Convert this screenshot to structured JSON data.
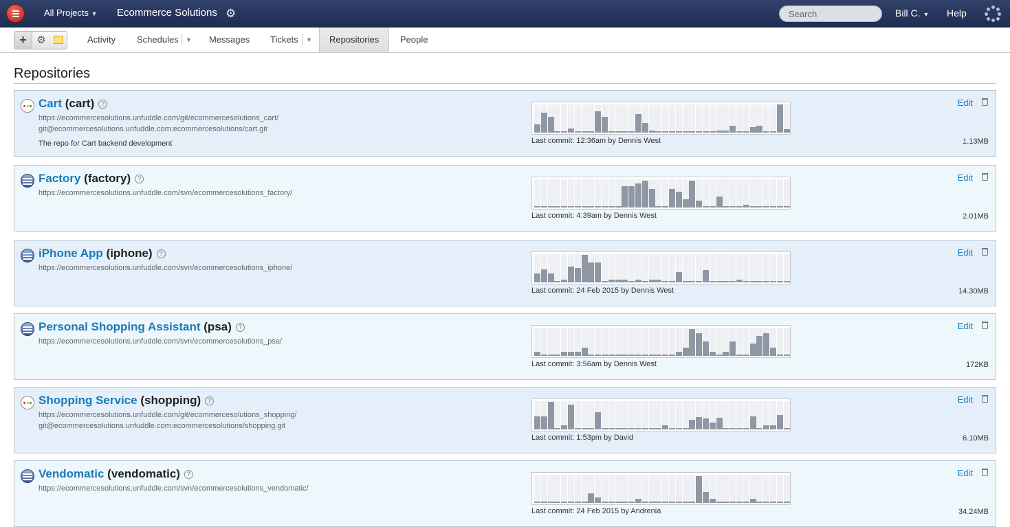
{
  "topbar": {
    "project_menu": "All Projects",
    "project_title": "Ecommerce Solutions",
    "search_placeholder": "Search",
    "user_menu": "Bill C.",
    "help": "Help"
  },
  "subnav": {
    "items": [
      {
        "label": "Activity"
      },
      {
        "label": "Schedules"
      },
      {
        "label": "Messages"
      },
      {
        "label": "Tickets"
      },
      {
        "label": "Repositories"
      },
      {
        "label": "People"
      }
    ]
  },
  "page": {
    "title": "Repositories"
  },
  "repositories": [
    {
      "name": "Cart",
      "slug": "(cart)",
      "scm": "git",
      "urls": [
        "https://ecommercesolutions.unfuddle.com/git/ecommercesolutions_cart/",
        "git@ecommercesolutions.unfuddle.com:ecommercesolutions/cart.git"
      ],
      "description": "The repo for Cart backend development",
      "last_commit": "Last commit: 12:36am by Dennis West",
      "size": "1.13MB",
      "edit_label": "Edit",
      "activity": [
        12,
        28,
        22,
        2,
        2,
        6,
        2,
        2,
        2,
        30,
        22,
        2,
        2,
        2,
        2,
        26,
        14,
        3,
        2,
        2,
        2,
        2,
        2,
        2,
        2,
        2,
        2,
        3,
        3,
        10,
        2,
        2,
        8,
        10,
        2,
        2,
        40,
        5
      ]
    },
    {
      "name": "Factory",
      "slug": "(factory)",
      "scm": "svn",
      "urls": [
        "https://ecommercesolutions.unfuddle.com/svn/ecommercesolutions_factory/"
      ],
      "description": "",
      "last_commit": "Last commit: 4:39am by Dennis West",
      "size": "2.01MB",
      "edit_label": "Edit",
      "activity": [
        2,
        2,
        2,
        2,
        2,
        2,
        2,
        2,
        2,
        2,
        2,
        2,
        2,
        30,
        30,
        34,
        38,
        26,
        2,
        2,
        26,
        22,
        12,
        38,
        10,
        2,
        2,
        16,
        2,
        2,
        2,
        4,
        2,
        2,
        2,
        2,
        2,
        2
      ]
    },
    {
      "name": "iPhone App",
      "slug": "(iphone)",
      "scm": "svn",
      "urls": [
        "https://ecommercesolutions.unfuddle.com/svn/ecommercesolutions_iphone/"
      ],
      "description": "",
      "last_commit": "Last commit: 24 Feb 2015 by Dennis West",
      "size": "14.30MB",
      "edit_label": "Edit",
      "activity": [
        13,
        19,
        13,
        2,
        4,
        22,
        20,
        39,
        28,
        28,
        2,
        4,
        4,
        4,
        2,
        4,
        2,
        4,
        4,
        2,
        2,
        15,
        2,
        2,
        2,
        18,
        2,
        2,
        2,
        2,
        4,
        2,
        2,
        2,
        2,
        2,
        2,
        2
      ]
    },
    {
      "name": "Personal Shopping Assistant",
      "slug": "(psa)",
      "scm": "svn",
      "urls": [
        "https://ecommercesolutions.unfuddle.com/svn/ecommercesolutions_psa/"
      ],
      "description": "",
      "last_commit": "Last commit: 3:56am by Dennis West",
      "size": "172KB",
      "edit_label": "Edit",
      "activity": [
        6,
        2,
        2,
        2,
        6,
        6,
        6,
        12,
        2,
        2,
        2,
        2,
        2,
        2,
        2,
        2,
        2,
        2,
        2,
        2,
        2,
        6,
        12,
        38,
        32,
        20,
        6,
        2,
        6,
        20,
        2,
        2,
        18,
        28,
        32,
        12,
        2,
        2
      ]
    },
    {
      "name": "Shopping Service",
      "slug": "(shopping)",
      "scm": "git",
      "urls": [
        "https://ecommercesolutions.unfuddle.com/git/ecommercesolutions_shopping/",
        "git@ecommercesolutions.unfuddle.com:ecommercesolutions/shopping.git"
      ],
      "description": "",
      "last_commit": "Last commit: 1:53pm by David",
      "size": "6.10MB",
      "edit_label": "Edit",
      "activity": [
        19,
        19,
        39,
        2,
        6,
        35,
        2,
        2,
        2,
        24,
        2,
        2,
        2,
        2,
        2,
        2,
        2,
        2,
        2,
        6,
        2,
        2,
        2,
        14,
        18,
        16,
        10,
        17,
        2,
        2,
        2,
        2,
        19,
        2,
        6,
        6,
        20,
        2
      ]
    },
    {
      "name": "Vendomatic",
      "slug": "(vendomatic)",
      "scm": "svn",
      "urls": [
        "https://ecommercesolutions.unfuddle.com/svn/ecommercesolutions_vendomatic/"
      ],
      "description": "",
      "last_commit": "Last commit: 24 Feb 2015 by Andrenia",
      "size": "34.24MB",
      "edit_label": "Edit",
      "activity": [
        2,
        2,
        2,
        2,
        2,
        2,
        2,
        2,
        14,
        8,
        2,
        2,
        2,
        2,
        2,
        6,
        2,
        2,
        2,
        2,
        2,
        2,
        2,
        2,
        38,
        16,
        6,
        2,
        2,
        2,
        2,
        2,
        6,
        2,
        2,
        2,
        2,
        2
      ]
    }
  ],
  "colors": {
    "topbar": "#25335c",
    "link": "#1a7bb9",
    "bar": "#8e97a3",
    "row_tint_a": "#e4effa",
    "row_tint_b": "#eef7fc"
  }
}
